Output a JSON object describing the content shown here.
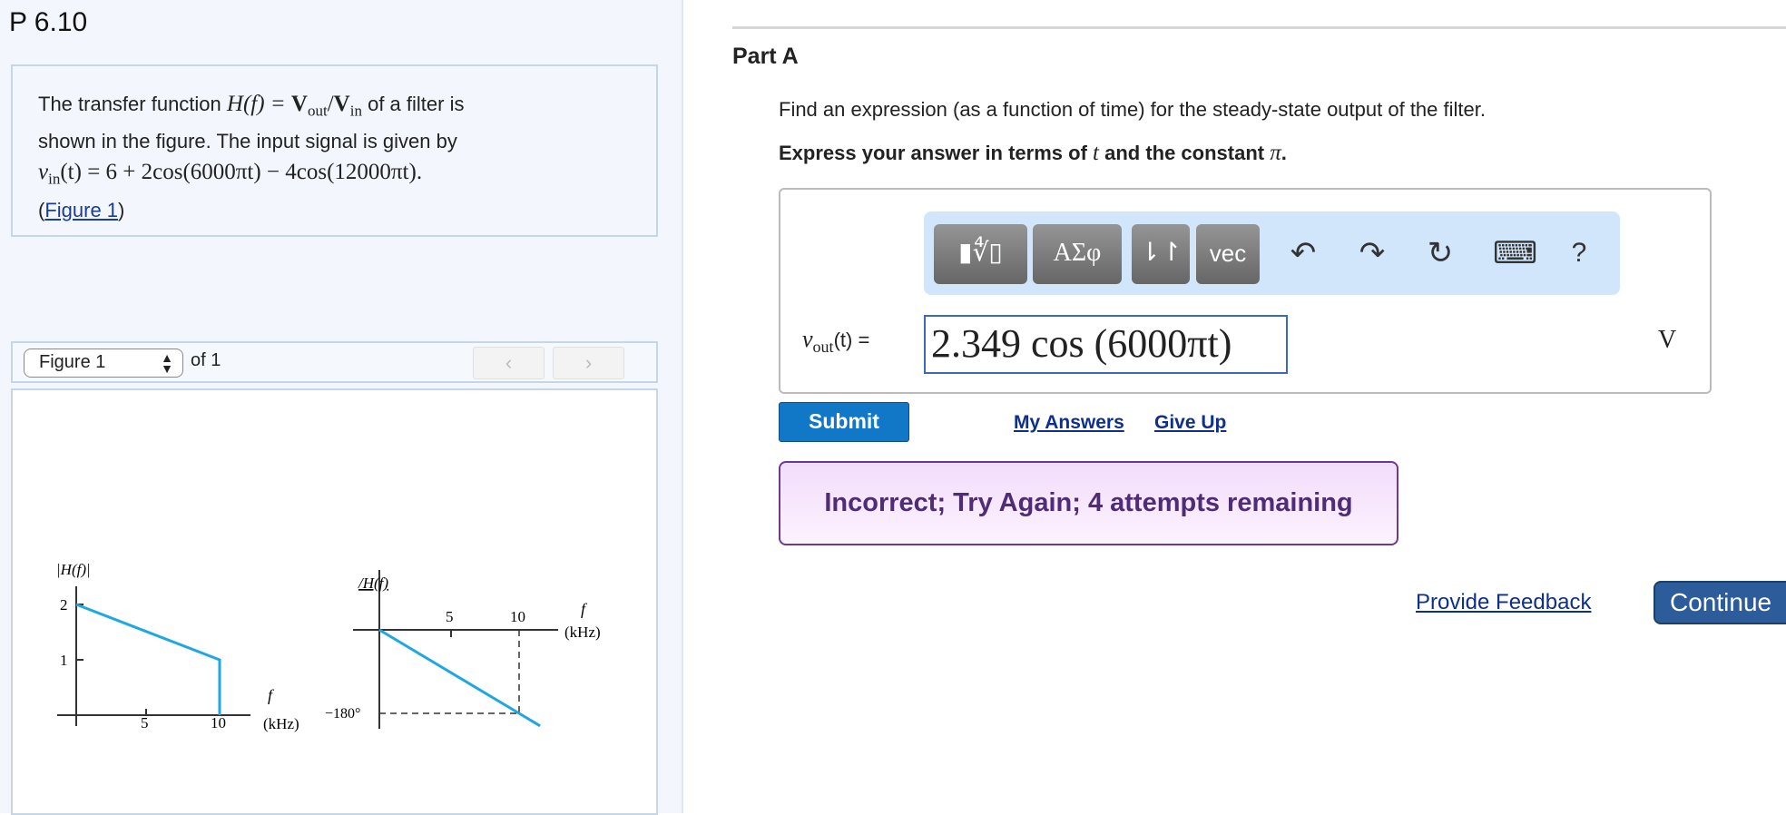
{
  "problem": {
    "title": "P 6.10",
    "text1": "The transfer function ",
    "hf": "H(f) = ",
    "vout_bold": "V",
    "out": "out",
    "slash": "/",
    "vin_bold": "V",
    "in": "in",
    "text2": " of a filter is",
    "line2": "shown in the figure. The input signal is given by",
    "vin_expr": "v",
    "vin_sub": "in",
    "vin_rest": "(t) = 6 + 2cos(6000πt) − 4cos(12000πt).",
    "fig_open": "(",
    "fig_link": "Figure 1",
    "fig_close": ")"
  },
  "figure_nav": {
    "select_value": "Figure 1",
    "of": "of 1",
    "prev": "‹",
    "next": "›"
  },
  "chart_data": [
    {
      "type": "line",
      "title": "|H(f)|",
      "xlabel": "f (kHz)",
      "xticks": [
        "5",
        "10"
      ],
      "yticks": [
        "1",
        "2"
      ],
      "x": [
        0,
        10,
        10
      ],
      "y": [
        2,
        1,
        0
      ],
      "xlim": [
        0,
        13
      ],
      "ylim": [
        0,
        2.3
      ],
      "label_f": "f",
      "label_unit": "(kHz)"
    },
    {
      "type": "line",
      "title": "/H(f)",
      "xlabel": "f (kHz)",
      "xticks": [
        "5",
        "10"
      ],
      "yticks": [
        "−180°"
      ],
      "x": [
        0,
        10,
        11.5
      ],
      "y": [
        0,
        -180,
        -207
      ],
      "xlim": [
        0,
        12
      ],
      "label_f": "f",
      "label_unit": "(kHz)"
    }
  ],
  "part": {
    "title": "Part A",
    "question": "Find an expression (as a function of time) for the steady-state output of the filter.",
    "instr_a": "Express your answer in terms of ",
    "instr_t": "t",
    "instr_b": " and the constant ",
    "instr_pi": "π",
    "instr_c": "."
  },
  "toolbar": {
    "templates": "▮∜▯",
    "greek": "ΑΣφ",
    "arrows": "⇂↾",
    "vec": "vec",
    "undo": "↶",
    "redo": "↷",
    "reset": "↻",
    "keyboard": "⌨",
    "help": "?"
  },
  "answer": {
    "label_v": "v",
    "label_sub": "out",
    "label_rest": "(t) =",
    "value": "2.349 cos (6000πt)",
    "unit": "V"
  },
  "actions": {
    "submit": "Submit",
    "my_answers": "My Answers",
    "give_up": "Give Up"
  },
  "feedback": "Incorrect; Try Again; 4 attempts remaining",
  "footer": {
    "provide_feedback": "Provide Feedback",
    "continue": "Continue"
  },
  "colors": {
    "plot_line": "#1fa7e1",
    "submit": "#1178c8",
    "feedback_text": "#4e2c76"
  }
}
